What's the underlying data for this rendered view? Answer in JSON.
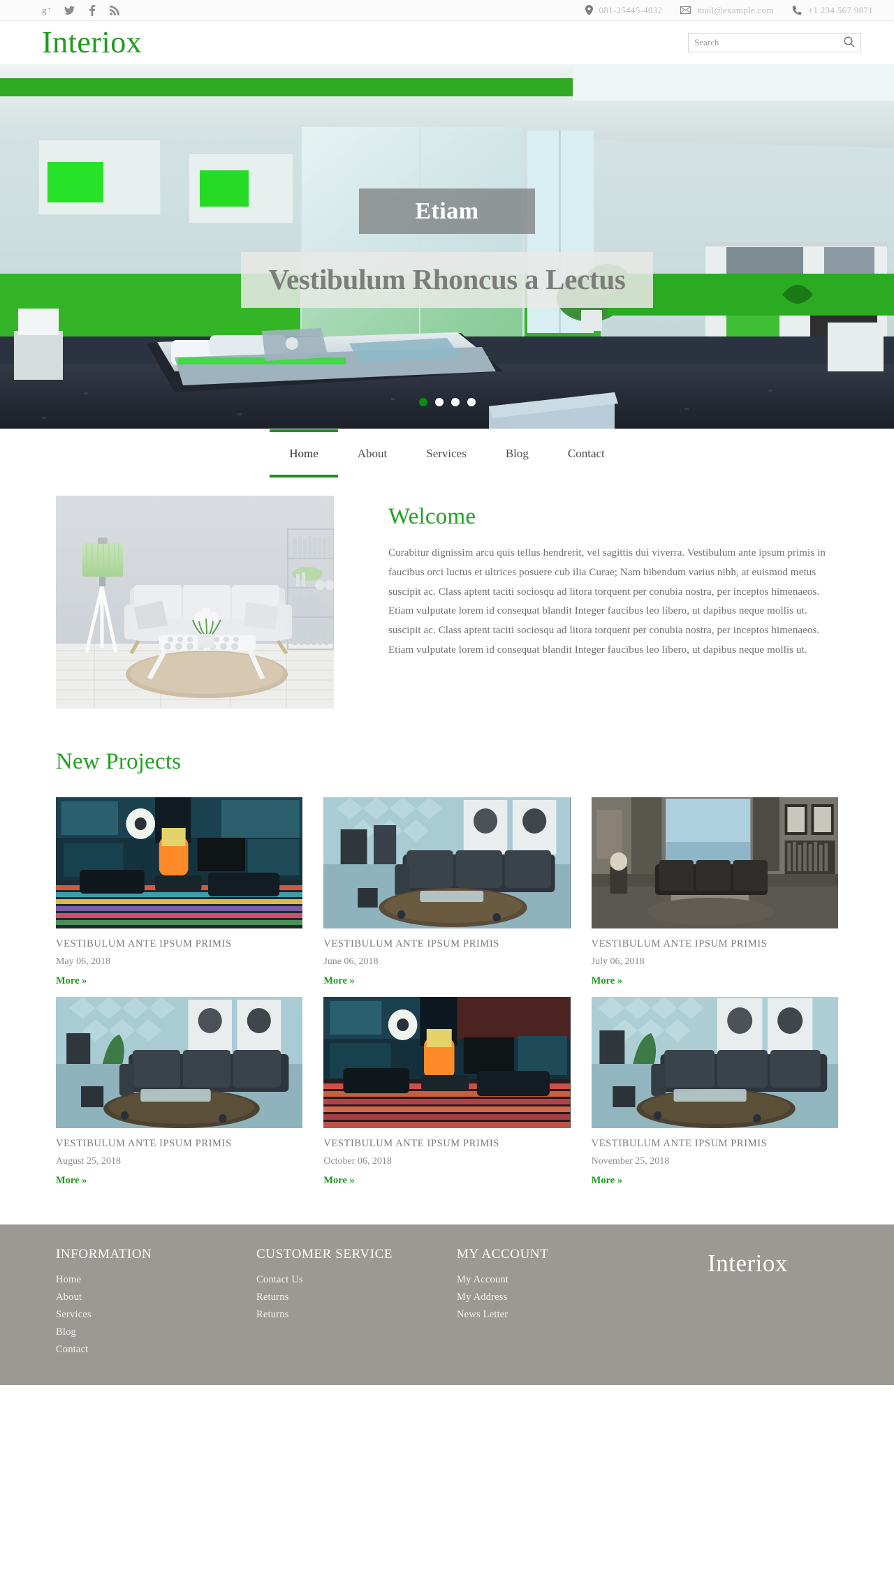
{
  "topbar": {
    "social": [
      {
        "name": "googleplus-icon",
        "label": "g+"
      },
      {
        "name": "twitter-icon",
        "label": "Twitter"
      },
      {
        "name": "facebook-icon",
        "label": "Facebook"
      },
      {
        "name": "rss-icon",
        "label": "RSS"
      }
    ],
    "address": "081-25445-4032",
    "email": "mail@example.com",
    "phone": "+1 234 567 9871",
    "address_icon": "location-pin-icon",
    "email_icon": "envelope-icon",
    "phone_icon": "phone-icon"
  },
  "header": {
    "logo": "Interiox",
    "search_placeholder": "Search",
    "search_value": "",
    "search_icon": "search-icon"
  },
  "hero": {
    "caption_small": "Etiam",
    "caption_big": "Vestibulum Rhoncus a Lectus",
    "dots": 4,
    "active_dot": 0
  },
  "nav": {
    "items": [
      {
        "label": "Home",
        "active": true
      },
      {
        "label": "About",
        "active": false
      },
      {
        "label": "Services",
        "active": false
      },
      {
        "label": "Blog",
        "active": false
      },
      {
        "label": "Contact",
        "active": false
      }
    ]
  },
  "welcome": {
    "heading": "Welcome",
    "body": "Curabitur dignissim arcu quis tellus hendrerit, vel sagittis dui viverra. Vestibulum ante ipsum primis in faucibus orci luctus et ultrices posuere cub ilia Curae; Nam bibendum varius nibh, at euismod metus suscipit ac. Class aptent taciti sociosqu ad litora torquent per conubia nostra, per inceptos himenaeos. Etiam vulputate lorem id consequat blandit Integer faucibus leo libero, ut dapibus neque mollis ut. suscipit ac. Class aptent taciti sociosqu ad litora torquent per conubia nostra, per inceptos himenaeos. Etiam vulputate lorem id consequat blandit Integer faucibus leo libero, ut dapibus neque mollis ut."
  },
  "projects": {
    "heading": "New Projects",
    "more_label": "More »",
    "items": [
      {
        "title": "VESTIBULUM ANTE IPSUM PRIMIS",
        "date": "May 06, 2018",
        "more": "More »"
      },
      {
        "title": "VESTIBULUM ANTE IPSUM PRIMIS",
        "date": "June 06, 2018",
        "more": "More »"
      },
      {
        "title": "VESTIBULUM ANTE IPSUM PRIMIS",
        "date": "July 06, 2018",
        "more": "More »"
      },
      {
        "title": "VESTIBULUM ANTE IPSUM PRIMIS",
        "date": "August 25, 2018",
        "more": "More »"
      },
      {
        "title": "VESTIBULUM ANTE IPSUM PRIMIS",
        "date": "October 06, 2018",
        "more": "More »"
      },
      {
        "title": "VESTIBULUM ANTE IPSUM PRIMIS",
        "date": "November 25, 2018",
        "more": "More »"
      }
    ]
  },
  "footer": {
    "columns": [
      {
        "head": "INFORMATION",
        "links": [
          "Home",
          "About",
          "Services",
          "Blog",
          "Contact"
        ]
      },
      {
        "head": "CUSTOMER SERVICE",
        "links": [
          "Contact Us",
          "Returns",
          "Returns"
        ]
      },
      {
        "head": "MY ACCOUNT",
        "links": [
          "My Account",
          "My Address",
          "News Letter"
        ]
      }
    ],
    "logo": "Interiox"
  },
  "colors": {
    "brand_green": "#1d9b1d",
    "accent_green": "#179417",
    "footer_bg": "#9c9894",
    "body_text": "#6f6f6f",
    "muted": "#bdbdbd"
  }
}
